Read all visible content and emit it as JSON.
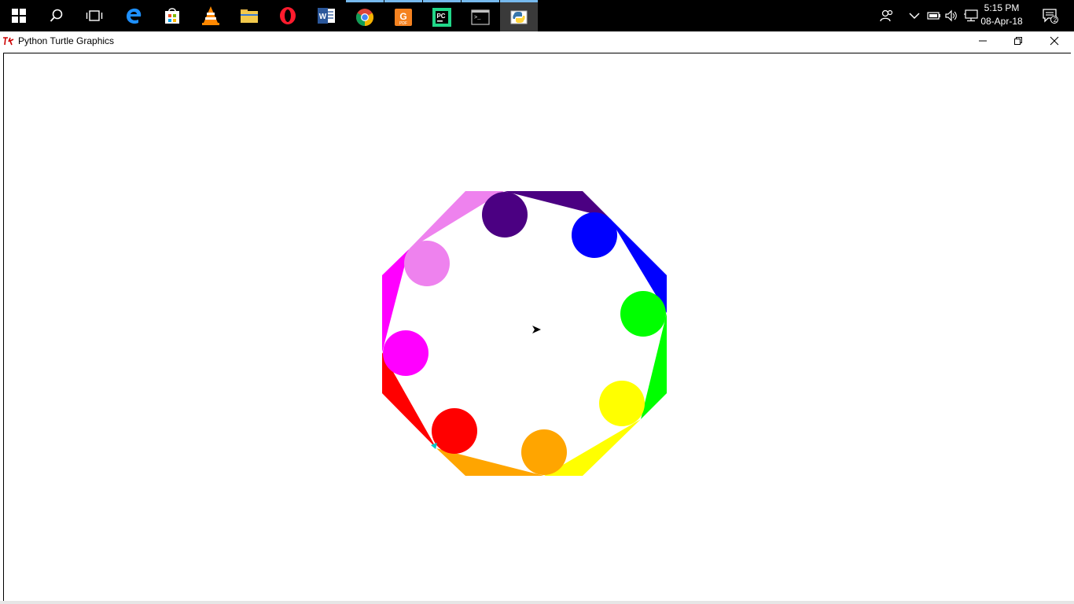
{
  "taskbar": {
    "background": "#000000",
    "apps": [
      {
        "name": "start",
        "icon": "windows-logo-icon"
      },
      {
        "name": "search",
        "icon": "search-icon"
      },
      {
        "name": "task-view",
        "icon": "task-view-icon"
      },
      {
        "name": "edge",
        "icon": "edge-icon"
      },
      {
        "name": "store",
        "icon": "store-icon"
      },
      {
        "name": "vlc",
        "icon": "vlc-icon"
      },
      {
        "name": "file-explorer",
        "icon": "folder-icon"
      },
      {
        "name": "opera",
        "icon": "opera-icon"
      },
      {
        "name": "word",
        "icon": "word-icon"
      },
      {
        "name": "chrome",
        "icon": "chrome-icon"
      },
      {
        "name": "pdf-editor",
        "icon": "pdf-icon"
      },
      {
        "name": "pycharm",
        "icon": "pycharm-icon"
      },
      {
        "name": "terminal",
        "icon": "terminal-icon"
      },
      {
        "name": "python",
        "icon": "python-icon"
      }
    ],
    "tray": {
      "time": "5:15 PM",
      "date": "08-Apr-18",
      "notification_count": "2"
    }
  },
  "window": {
    "title": "Python Turtle Graphics",
    "canvas_background": "#ffffff"
  },
  "drawing": {
    "octagon_colors": [
      "#4b0082",
      "#0000ff",
      "#00ff00",
      "#ffff00",
      "#ffa500",
      "#ff0000",
      "#ff00ff",
      "#ee82ee"
    ],
    "circle_colors": [
      "#4b0082",
      "#0000ff",
      "#00ff00",
      "#ffff00",
      "#ffa500",
      "#ff0000",
      "#ff00ff",
      "#ee82ee"
    ],
    "turtle_color": "#000000",
    "cursor_color": "#00c8c8"
  }
}
